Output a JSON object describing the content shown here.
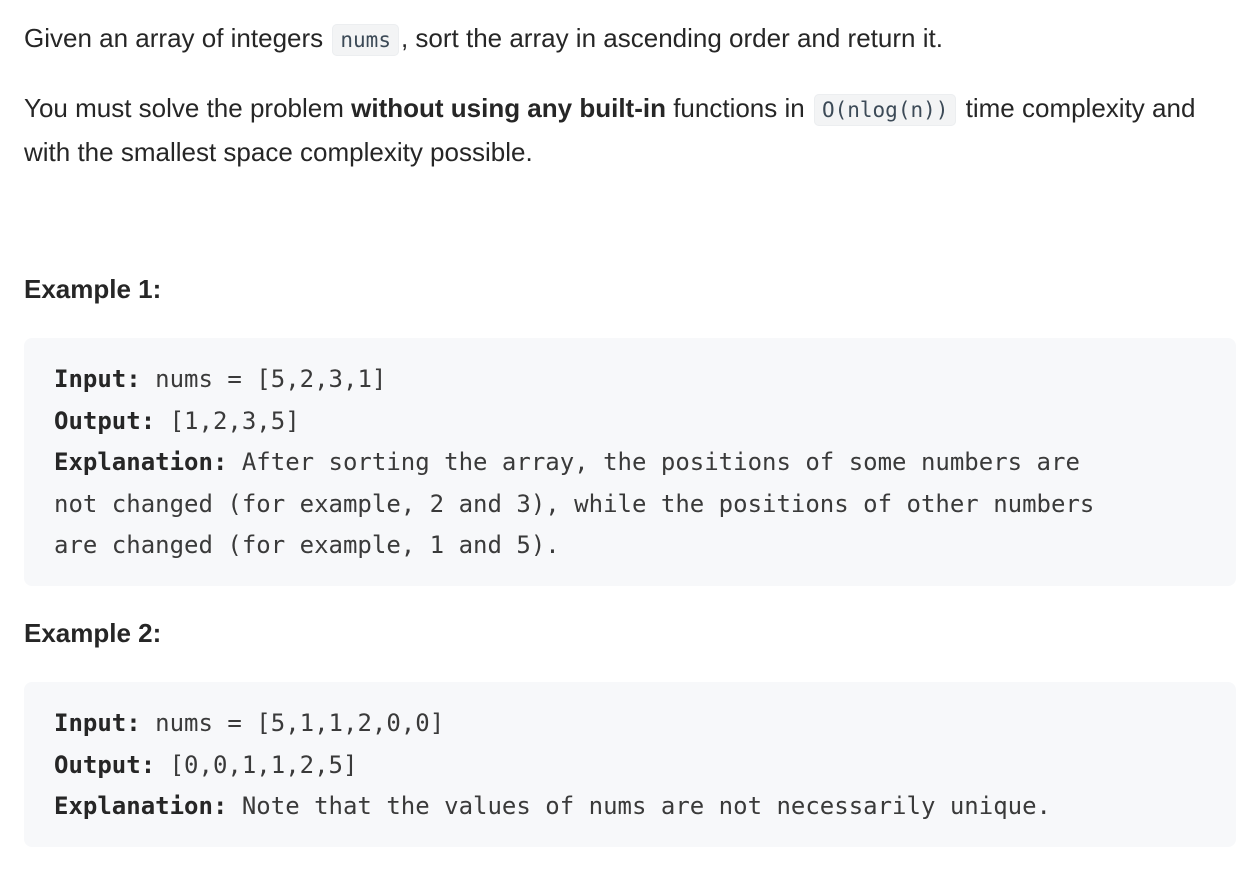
{
  "description": {
    "line1_part1": "Given an array of integers",
    "line1_code": "nums",
    "line1_part2": ", sort the array in ascending order and return it.",
    "line2_part1": "You must solve the problem",
    "line2_bold": "without using any built-in",
    "line2_part2": "functions in",
    "line2_code": "O(nlog(n))",
    "line2_part3": "time complexity and with the smallest space complexity possible."
  },
  "examples": [
    {
      "heading": "Example 1:",
      "input_label": "Input:",
      "input_value": " nums = [5,2,3,1]",
      "output_label": "Output:",
      "output_value": " [1,2,3,5]",
      "explanation_label": "Explanation:",
      "explanation_line1": " After sorting the array, the positions of some numbers are",
      "explanation_line2": "not changed (for example, 2 and 3), while the positions of other numbers",
      "explanation_line3": "are changed (for example, 1 and 5)."
    },
    {
      "heading": "Example 2:",
      "input_label": "Input:",
      "input_value": " nums = [5,1,1,2,0,0]",
      "output_label": "Output:",
      "output_value": " [0,0,1,1,2,5]",
      "explanation_label": "Explanation:",
      "explanation_line1": " Note that the values of nums are not necessarily unique."
    }
  ]
}
